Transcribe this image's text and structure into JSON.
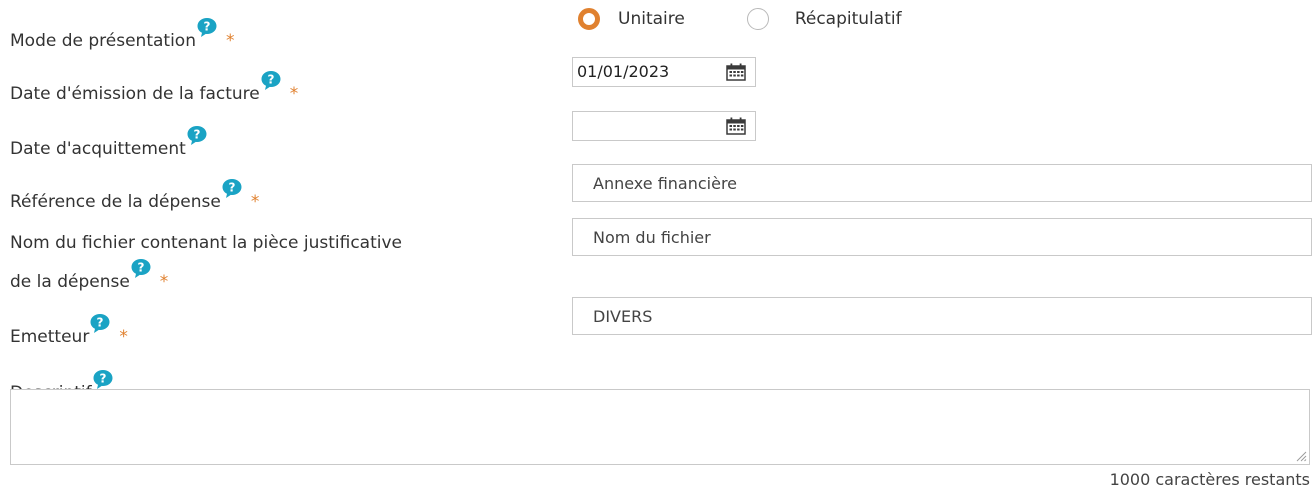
{
  "colors": {
    "help_badge": "#1aa3c4",
    "required_asterisk": "#e0812f",
    "radio_checked": "#e0812f",
    "border": "#c9c9c9"
  },
  "icons": {
    "help": "question-bubble-icon",
    "calendar": "calendar-icon",
    "resize": "resize-handle-icon"
  },
  "help_mark": "?",
  "required_mark": "*",
  "presentation": {
    "label": "Mode de présentation",
    "options": [
      "Unitaire",
      "Récapitulatif"
    ],
    "selected": "Unitaire"
  },
  "invoice_date": {
    "label": "Date d'émission de la facture",
    "value": "01/01/2023"
  },
  "payment_date": {
    "label": "Date d'acquittement",
    "value": ""
  },
  "expense_ref": {
    "label": "Référence de la dépense",
    "value": "Annexe financière"
  },
  "file_name": {
    "label_line1": "Nom du fichier contenant la pièce justificative",
    "label_line2": "de la dépense",
    "value": "Nom du fichier"
  },
  "issuer": {
    "label": "Emetteur",
    "value": "DIVERS"
  },
  "description": {
    "label": "Descriptif",
    "value": "",
    "counter": "1000 caractères restants"
  }
}
